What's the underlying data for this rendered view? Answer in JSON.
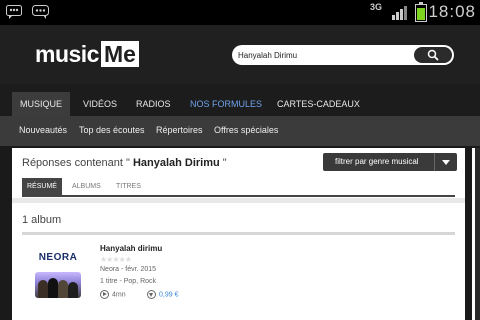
{
  "status_bar": {
    "network": "3G",
    "time": "18:08",
    "icons": [
      "bbm-notification-icon",
      "chat-notification-icon",
      "signal-icon",
      "battery-icon"
    ]
  },
  "header": {
    "logo_part1": "music",
    "logo_part2": "Me",
    "search_value": "Hanyalah Dirimu",
    "search_icon": "search-icon"
  },
  "nav": {
    "items": [
      {
        "label": "MUSIQUE"
      },
      {
        "label": "VIDÉOS"
      },
      {
        "label": "RADIOS"
      },
      {
        "label": "NOS FORMULES"
      },
      {
        "label": "CARTES-CADEAUX"
      }
    ],
    "active": "MUSIQUE"
  },
  "subnav": {
    "items": [
      {
        "label": "Nouveautés"
      },
      {
        "label": "Top des écoutes"
      },
      {
        "label": "Répertoires"
      },
      {
        "label": "Offres spéciales"
      }
    ]
  },
  "results": {
    "prefix": "Réponses contenant \" ",
    "query": "Hanyalah Dirimu",
    "suffix": " \"",
    "filter_label": "filtrer par genre musical",
    "tabs": [
      "RÉSUMÉ",
      "ALBUMS",
      "TITRES"
    ],
    "active_tab": "RÉSUMÉ",
    "count_label": "1 album"
  },
  "album": {
    "title": "Hanyalah dirimu",
    "rating_stars": "★★★★★",
    "artist_date": "Neora - févr. 2015",
    "details": "1 titre - Pop, Rock",
    "duration": "4mn",
    "price": "0,99 €",
    "cover_text": "NEORA",
    "colors": {
      "accent_link": "#3a86d5",
      "nav_highlight": "#6fa3ea"
    }
  }
}
